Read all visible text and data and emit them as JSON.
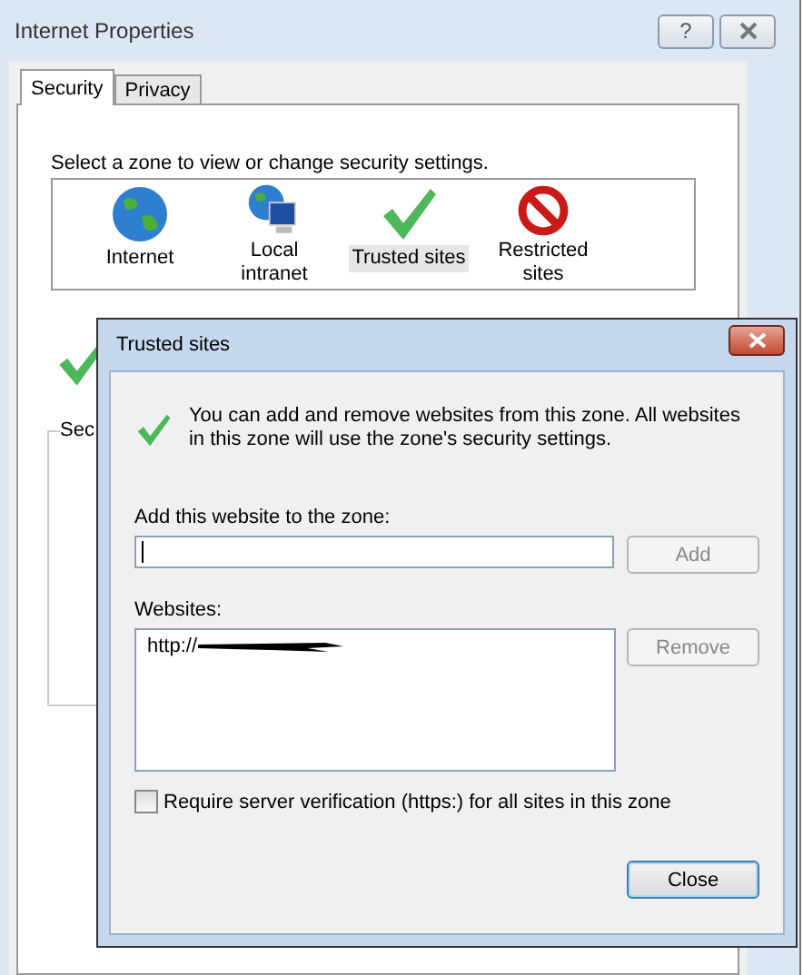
{
  "window": {
    "title": "Internet Properties",
    "help_button": "?"
  },
  "tabs": [
    {
      "label": "Security",
      "selected": true
    },
    {
      "label": "Privacy",
      "selected": false
    }
  ],
  "zone_prompt": "Select a zone to view or change security settings.",
  "zones": [
    {
      "kind": "globe",
      "label": "Internet",
      "selected": false
    },
    {
      "kind": "intranet",
      "label": "Local intranet",
      "selected": false
    },
    {
      "kind": "check",
      "label": "Trusted sites",
      "selected": true
    },
    {
      "kind": "blocked",
      "label": "Restricted sites",
      "selected": false
    }
  ],
  "security_group": {
    "label": "Sec"
  },
  "dialog": {
    "title": "Trusted sites",
    "message": "You can add and remove websites from this zone. All websites in this zone will use the zone's security settings.",
    "add_label": "Add this website to the zone:",
    "add_button": {
      "label": "Add",
      "disabled": true
    },
    "websites_label": "Websites:",
    "websites": [
      {
        "text": "http://",
        "redacted": true
      }
    ],
    "remove_button": {
      "label": "Remove",
      "disabled": true
    },
    "https_checkbox": {
      "label": "Require server verification (https:) for all sites in this zone",
      "checked": false
    },
    "close_button": {
      "label": "Close",
      "default": true
    }
  }
}
